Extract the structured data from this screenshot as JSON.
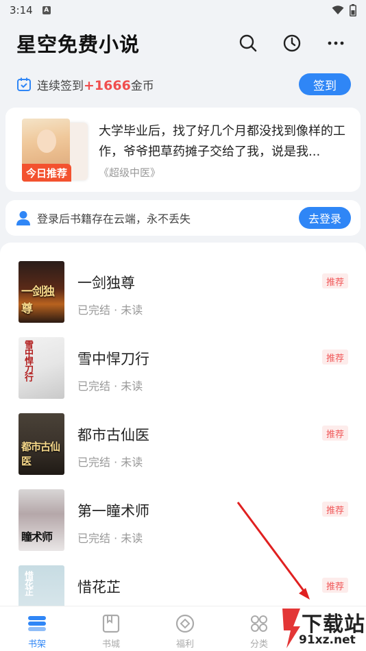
{
  "status_bar": {
    "time": "3:14",
    "notification_letter": "A"
  },
  "header": {
    "title": "星空免费小说",
    "icons": [
      "search-icon",
      "history-clock-icon",
      "more-icon"
    ]
  },
  "checkin": {
    "prefix": "连续签到",
    "count": "+1666",
    "suffix": "金币",
    "button_label": "签到"
  },
  "recommendation": {
    "badge": "今日推荐",
    "description": "大学毕业后，找了好几个月都没找到像样的工作，爷爷把草药摊子交给了我，说是我...",
    "book": "《超级中医》"
  },
  "login": {
    "text": "登录后书籍存在云端，永不丢失",
    "button_label": "去登录"
  },
  "books": [
    {
      "title": "一剑独尊",
      "status": "已完结 · 未读",
      "tag": "推荐",
      "cover_text": "一剑独尊"
    },
    {
      "title": "雪中悍刀行",
      "status": "已完结 · 未读",
      "tag": "推荐",
      "cover_text": "雪中悍刀行"
    },
    {
      "title": "都市古仙医",
      "status": "已完结 · 未读",
      "tag": "推荐",
      "cover_text": "都市古仙医"
    },
    {
      "title": "第一瞳术师",
      "status": "已完结 · 未读",
      "tag": "推荐",
      "cover_text": "瞳术师"
    },
    {
      "title": "惜花芷",
      "status": "",
      "tag": "推荐",
      "cover_text": "惜花芷"
    }
  ],
  "tabbar": {
    "items": [
      "书架",
      "书城",
      "福利",
      "分类"
    ],
    "active_index": 0
  },
  "watermark": {
    "text": "下载站",
    "url": "91xz.net"
  },
  "colors": {
    "accent": "#2f86f6",
    "badge_red": "#f3522f",
    "tag_red": "#f0595a"
  }
}
